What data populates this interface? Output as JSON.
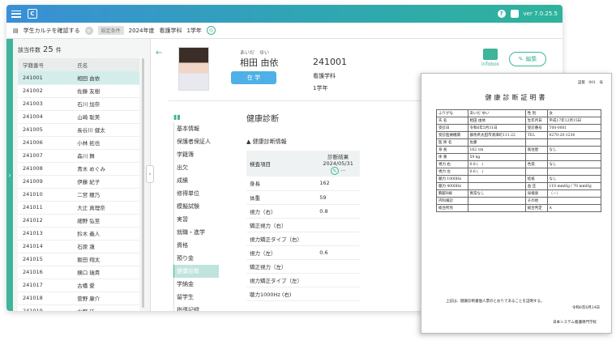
{
  "topbar": {
    "version": "ver 7.0.25.5",
    "help_icon": "question-icon",
    "logo_icon": "app-logo-icon"
  },
  "subbar": {
    "title": "学生カルテを確認する",
    "condition_tag": "設定条件",
    "year": "2024年度",
    "dept": "看護学科",
    "grade": "1学年"
  },
  "list": {
    "count_label": "該当件数",
    "count": "25",
    "count_unit": "件",
    "headers": [
      "学籍番号",
      "氏名"
    ],
    "rows": [
      [
        "241001",
        "相田 由依"
      ],
      [
        "241002",
        "佐藤 友樹"
      ],
      [
        "241003",
        "石川 加奈"
      ],
      [
        "241004",
        "山崎 聡美"
      ],
      [
        "241005",
        "長谷川 健太"
      ],
      [
        "241006",
        "小林 拓也"
      ],
      [
        "241007",
        "森川 舞"
      ],
      [
        "241008",
        "青木 めぐみ"
      ],
      [
        "241009",
        "伊藤 紀子"
      ],
      [
        "241010",
        "二宮 穣乃"
      ],
      [
        "241011",
        "大辻 真理奈"
      ],
      [
        "241012",
        "細野 弘至"
      ],
      [
        "241013",
        "鈴木 義人"
      ],
      [
        "241014",
        "石原 蓮"
      ],
      [
        "241015",
        "飯田 翔太"
      ],
      [
        "241016",
        "横口 瑞貴"
      ],
      [
        "241017",
        "古橋 愛"
      ],
      [
        "241018",
        "菅野 康介"
      ],
      [
        "241019",
        "水野 廷"
      ]
    ]
  },
  "student": {
    "ruby": "あいだ　ゆい",
    "name": "相田 由依",
    "status": "在 学",
    "id": "241001",
    "dept": "看護学科",
    "grade": "1学年",
    "infobox_label": "infobox",
    "edit_label": "編集"
  },
  "menu": [
    "基本情報",
    "保護者保証人",
    "学籍簿",
    "出欠",
    "成績",
    "修得単位",
    "模擬試験",
    "実習",
    "就職・進学",
    "資格",
    "預り金",
    "健康診断",
    "学納金",
    "留学生",
    "指導記録"
  ],
  "health": {
    "title": "健康診断",
    "subtitle": "健康診断情報",
    "col_item": "検査項目",
    "col_result": "診断結果",
    "col_date": "2024/05/31",
    "rows": [
      [
        "身長",
        "162"
      ],
      [
        "体重",
        "59"
      ],
      [
        "視力（右）",
        "0.8"
      ],
      [
        "矯正視力（右）",
        ""
      ],
      [
        "視力矯正タイプ（右）",
        ""
      ],
      [
        "視力（左）",
        "0.6"
      ],
      [
        "矯正視力（左）",
        ""
      ],
      [
        "視力矯正タイプ（左）",
        ""
      ],
      [
        "聴力1000Hz (右)",
        ""
      ]
    ]
  },
  "certificate": {
    "number": "証第　001　号",
    "title": "健康診断証明書",
    "rows": [
      [
        "ふりがな",
        "あいだ ゆい",
        "性 別",
        "女"
      ],
      [
        "氏 名",
        "相田 由依",
        "生年月日",
        "平成17年12月15日"
      ],
      [
        "受診日",
        "令和6年5月31日",
        "受診番号",
        "T00-0001"
      ],
      [
        "受診医療機関",
        "群馬県太田市清澤町111-22",
        "TEL",
        "0270-20-1234"
      ],
      [
        "医 師 名",
        "佐藤",
        "",
        ""
      ],
      [
        "身 長",
        "162 cm",
        "既往歴",
        "なし"
      ],
      [
        "体 重",
        "59 kg",
        "",
        ""
      ],
      [
        "視力 右",
        "0.8 (　)",
        "色覚",
        "なし"
      ],
      [
        "視力 左",
        "0.6 (　)",
        "",
        ""
      ],
      [
        "聴力 1000Hz",
        "",
        "結核",
        "なし"
      ],
      [
        "聴力 4000Hz",
        "",
        "血 圧",
        "110 mmHg / 70 mmHg"
      ],
      [
        "胸部X線",
        "異常なし",
        "尿検査",
        "（－）"
      ],
      [
        "内科検診",
        "",
        "その他",
        ""
      ],
      [
        "総合所見",
        "",
        "総合判定",
        "A"
      ]
    ],
    "statement": "上記は、健康診断書個人票のとおりであることを証明する。",
    "date": "令和6年6月24日",
    "school": "日本システム看護専門学校"
  }
}
